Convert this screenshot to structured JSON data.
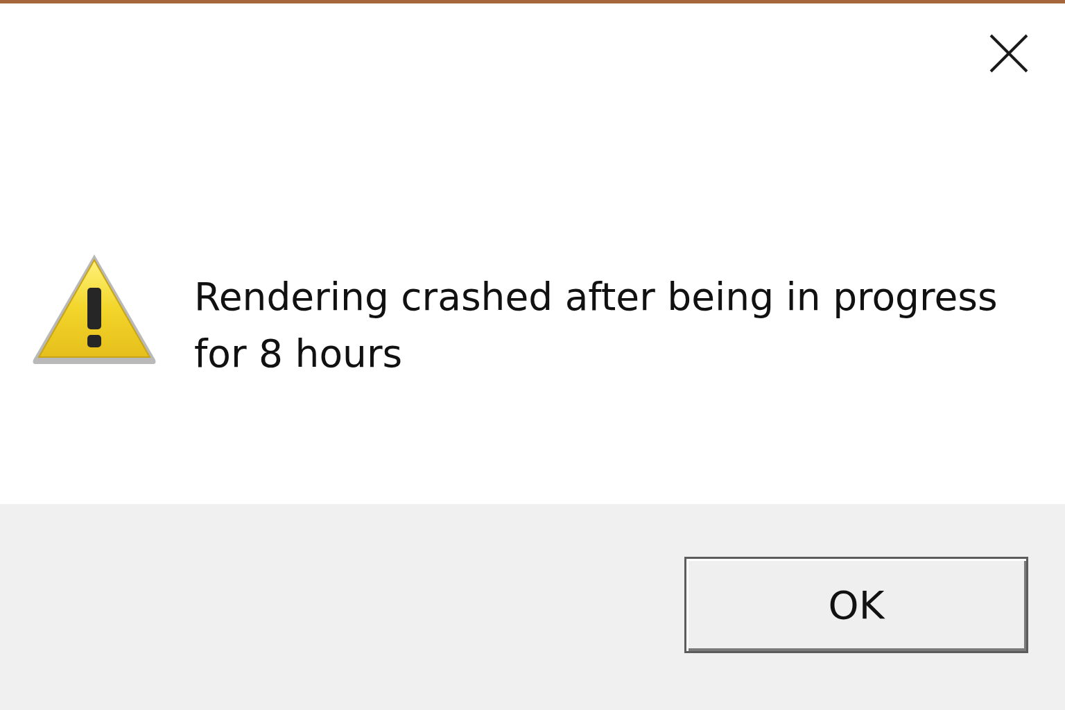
{
  "dialog": {
    "message": "Rendering crashed after being in progress for 8 hours",
    "buttons": [
      "OK"
    ]
  }
}
